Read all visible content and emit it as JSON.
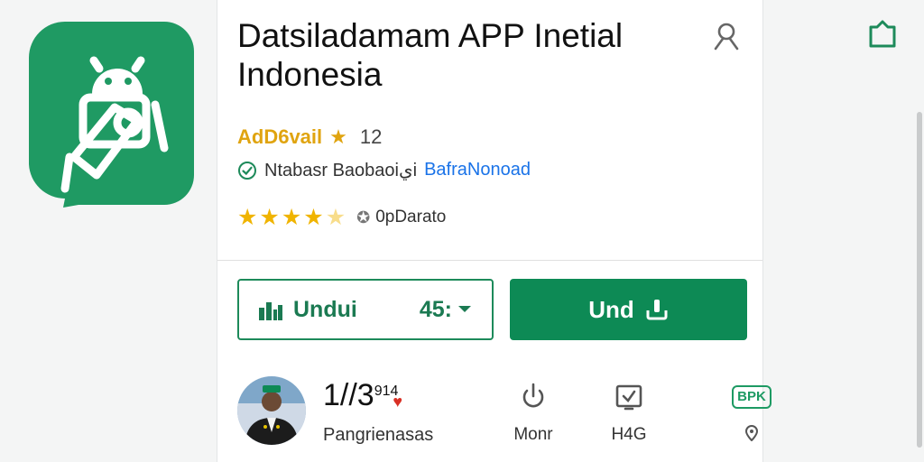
{
  "app": {
    "title": "Datsiladamam APP Inetial Indonesia",
    "developer": "AdD6vail",
    "rating_count": "12",
    "verified_label": "Ntabasr Baobaoiيi",
    "verified_link": "BafraNonoad",
    "stars_value": 4.5,
    "stars_label": "0pDarato"
  },
  "buttons": {
    "secondary_label": "Undui",
    "secondary_size": "45:",
    "primary_label": "Und"
  },
  "info": {
    "date_main": "1//3",
    "date_sup": "914",
    "subtitle": "Pangrienasas",
    "stats": [
      {
        "label": "Monr",
        "icon": "power-icon"
      },
      {
        "label": "H4G",
        "icon": "checkbox-icon"
      },
      {
        "label": "",
        "icon": "location-pin-icon",
        "badge": "BPK"
      }
    ]
  },
  "colors": {
    "brand_green": "#0d8a55",
    "star": "#f0b400",
    "developer": "#e0a410",
    "link": "#1a73e8"
  }
}
